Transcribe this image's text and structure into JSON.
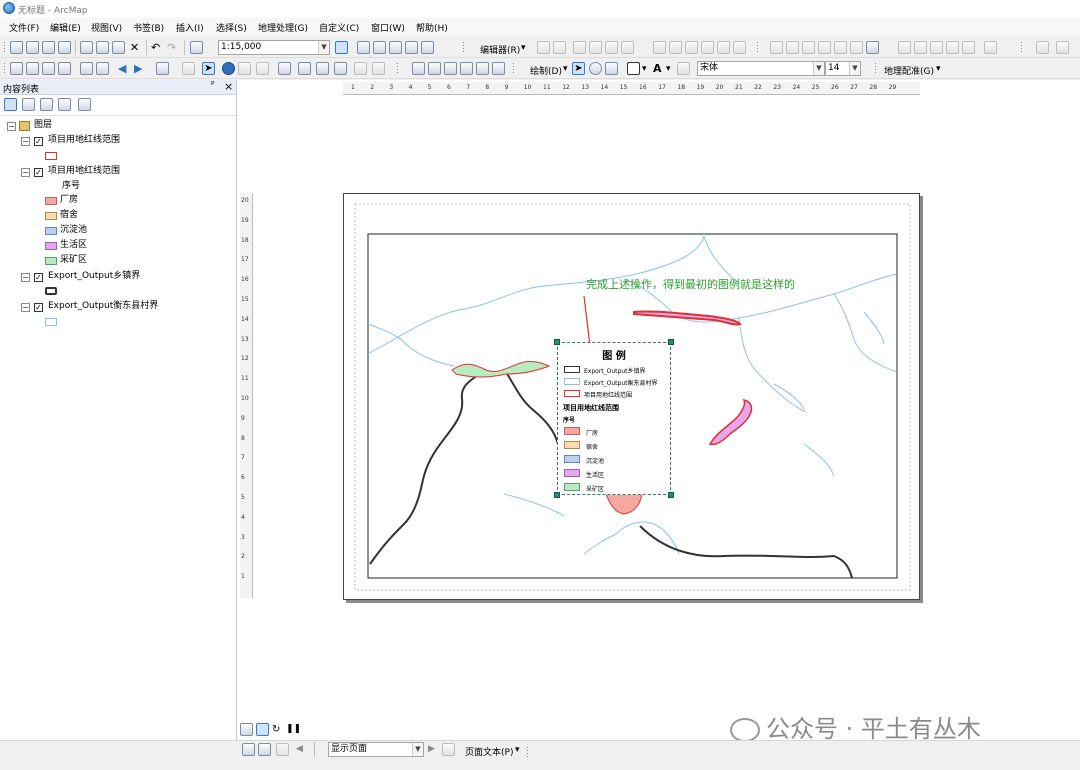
{
  "window": {
    "title": "无标题 - ArcMap"
  },
  "menu": [
    "文件(F)",
    "编辑(E)",
    "视图(V)",
    "书签(B)",
    "插入(I)",
    "选择(S)",
    "地理处理(G)",
    "自定义(C)",
    "窗口(W)",
    "帮助(H)"
  ],
  "toolbar1": {
    "scale": "1:15,000",
    "editor_label": "编辑器(R)"
  },
  "toolbar2": {
    "draw_label": "绘制(D)",
    "font_name": "宋体",
    "font_size": "14",
    "georef_label": "地理配准(G)"
  },
  "toc": {
    "title": "内容列表",
    "pin": "ᴾ",
    "close": "×",
    "root": "图层",
    "layers": [
      {
        "name": "项目用地红线范围"
      },
      {
        "name": "项目用地红线范围",
        "field": "序号",
        "classes": [
          {
            "label": "厂房",
            "color": "#f4a8a0"
          },
          {
            "label": "宿舍",
            "color": "#f8dcb0"
          },
          {
            "label": "沉淀池",
            "color": "#bcd0f2"
          },
          {
            "label": "生活区",
            "color": "#e6a6ee"
          },
          {
            "label": "采矿区",
            "color": "#b6ecc0"
          }
        ]
      },
      {
        "name": "Export_Output乡镇界"
      },
      {
        "name": "Export_Output衡东县村界"
      }
    ]
  },
  "map": {
    "annotation": "完成上述操作，得到最初的图例就是这样的"
  },
  "legend": {
    "title": "图  例",
    "items": [
      "Export_Output乡镇界",
      "Export_Output衡东县村界",
      "项目用地红线范围"
    ],
    "group_title": "项目用地红线范围",
    "field": "序号",
    "classes": [
      "厂房",
      "宿舍",
      "沉淀池",
      "生活区",
      "采矿区"
    ]
  },
  "ruler": {
    "h_ticks": [
      "1",
      "2",
      "3",
      "4",
      "5",
      "6",
      "7",
      "8",
      "9",
      "10",
      "11",
      "12",
      "13",
      "14",
      "15",
      "16",
      "17",
      "18",
      "19",
      "20",
      "21",
      "22",
      "23",
      "24",
      "25",
      "26",
      "27",
      "28",
      "29"
    ],
    "v_ticks": [
      "20",
      "19",
      "18",
      "17",
      "16",
      "15",
      "14",
      "13",
      "12",
      "11",
      "10",
      "9",
      "8",
      "7",
      "6",
      "5",
      "4",
      "3",
      "2",
      "1"
    ]
  },
  "statusbar": {
    "page_select": "显示页面",
    "page_text": "页面文本(P)"
  },
  "watermark": "公众号 · 平土有丛木",
  "colors": {
    "red_outline": "#e03030",
    "river": "#8cc0ee",
    "boundary": "#333333",
    "annotation": "#2ca02c"
  }
}
